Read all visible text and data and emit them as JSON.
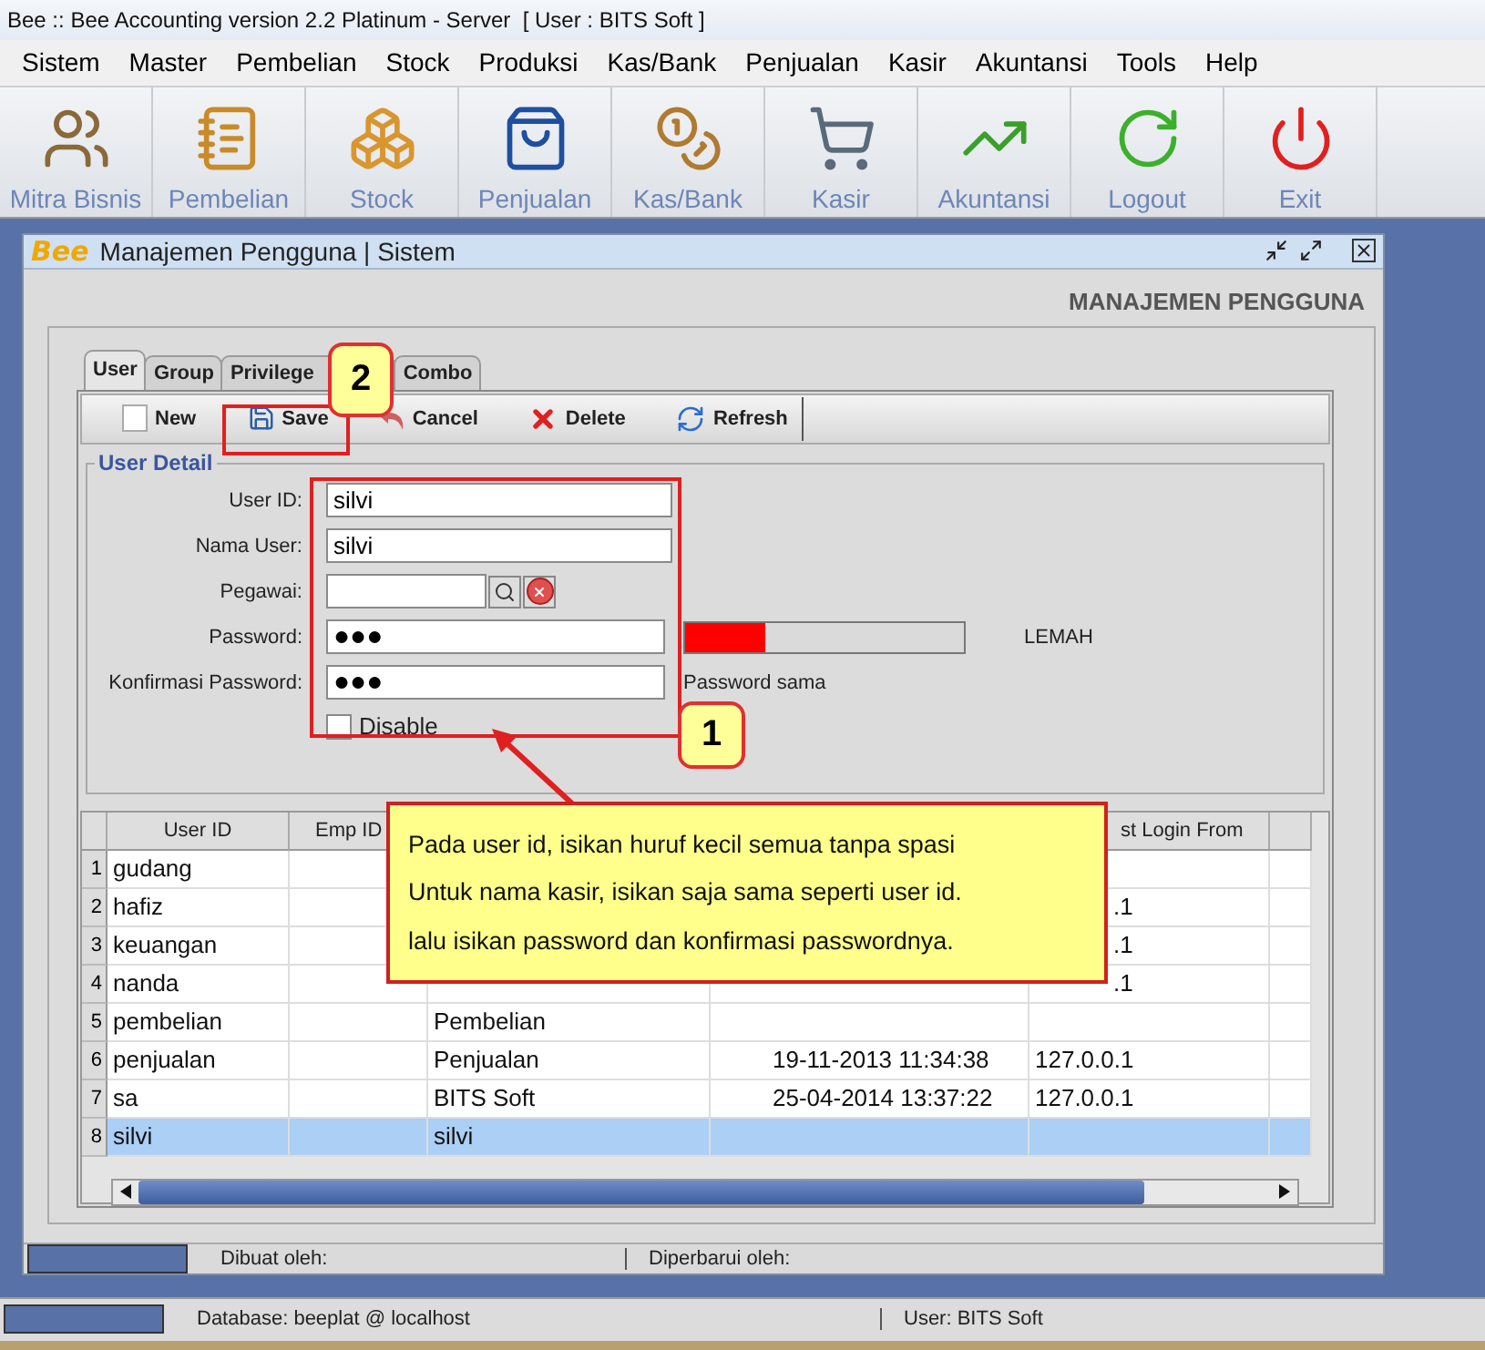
{
  "window": {
    "title": "Bee :: Bee Accounting version 2.2 Platinum - Server  [ User : BITS Soft ]"
  },
  "menu": [
    "Sistem",
    "Master",
    "Pembelian",
    "Stock",
    "Produksi",
    "Kas/Bank",
    "Penjualan",
    "Kasir",
    "Akuntansi",
    "Tools",
    "Help"
  ],
  "toolbar": [
    "Mitra Bisnis",
    "Pembelian",
    "Stock",
    "Penjualan",
    "Kas/Bank",
    "Kasir",
    "Akuntansi",
    "Logout",
    "Exit"
  ],
  "inner_window": {
    "logo": "Bee",
    "title": "Manajemen Pengguna | Sistem",
    "heading": "MANAJEMEN PENGGUNA"
  },
  "tabs": [
    {
      "label": "User",
      "selected": true
    },
    {
      "label": "Group",
      "selected": false
    },
    {
      "label": "Privilege",
      "selected": false
    },
    {
      "label": "Combo",
      "selected": false
    }
  ],
  "actions": [
    "New",
    "Save",
    "Cancel",
    "Delete",
    "Refresh"
  ],
  "user_detail": {
    "title": "User Detail",
    "fields": [
      {
        "label": "User ID:",
        "value": "silvi",
        "kind": "text"
      },
      {
        "label": "Nama User:",
        "value": "silvi",
        "kind": "text"
      },
      {
        "label": "Pegawai:",
        "kind": "lookup"
      },
      {
        "label": "Password:",
        "value": "●●●",
        "kind": "password"
      },
      {
        "label": "Konfirmasi Password:",
        "value": "●●●",
        "kind": "confirm"
      }
    ],
    "strength": {
      "level": 0.29,
      "reading": "LEMAH"
    },
    "match": "Password sama",
    "disable": {
      "label": "Disable",
      "checked": false
    }
  },
  "table": {
    "columns": [
      {
        "label": "User ID"
      },
      {
        "label": "Emp ID"
      },
      {},
      {},
      {
        "label": "st Login From"
      },
      {}
    ],
    "rows": [
      {
        "num": "1",
        "user_id": "gudang",
        "selected": false,
        "ip_cut": false
      },
      {
        "num": "2",
        "user_id": "hafiz",
        "ip": ".1",
        "selected": false,
        "ip_cut": true
      },
      {
        "num": "3",
        "user_id": "keuangan",
        "ip": ".1",
        "selected": false,
        "ip_cut": true
      },
      {
        "num": "4",
        "user_id": "nanda",
        "ip": ".1",
        "selected": false,
        "ip_cut": true
      },
      {
        "num": "5",
        "user_id": "pembelian",
        "name": "Pembelian",
        "selected": false,
        "ip_cut": false
      },
      {
        "num": "6",
        "user_id": "penjualan",
        "name": "Penjualan",
        "login": "19-11-2013 11:34:38",
        "ip": "127.0.0.1",
        "selected": false,
        "ip_cut": false
      },
      {
        "num": "7",
        "user_id": "sa",
        "name": "BITS Soft",
        "login": "25-04-2014 13:37:22",
        "ip": "127.0.0.1",
        "selected": false,
        "ip_cut": false
      },
      {
        "num": "8",
        "user_id": "silvi",
        "name": "silvi",
        "selected": true,
        "ip_cut": false
      }
    ]
  },
  "callouts": [
    "2",
    "1"
  ],
  "note": [
    "Pada user id, isikan huruf kecil semua tanpa spasi",
    "Untuk nama kasir, isikan saja sama seperti user id.",
    "lalu isikan password dan konfirmasi passwordnya."
  ],
  "inner_status": {
    "created": "Dibuat oleh:",
    "updated": "Diperbarui oleh:"
  },
  "status_bar": {
    "database": "Database: beeplat @ localhost",
    "user": "User: BITS Soft"
  }
}
